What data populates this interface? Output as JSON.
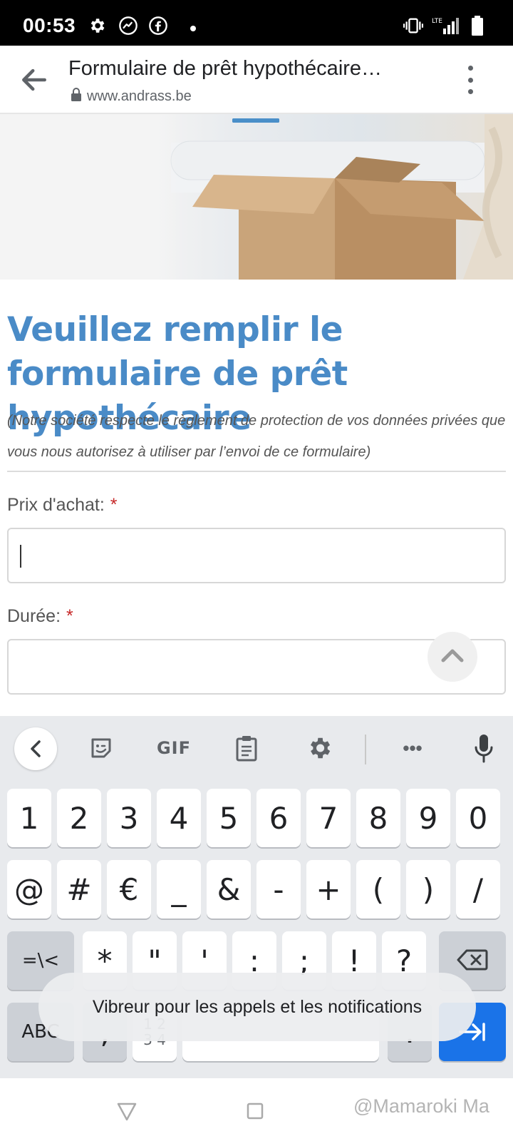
{
  "status_bar": {
    "time": "00:53",
    "network": "LTE",
    "icons": [
      "gear-icon",
      "messenger-icon",
      "facebook-icon",
      "notification-dot",
      "vibrate-icon",
      "lte-signal-icon",
      "battery-icon"
    ]
  },
  "browser": {
    "page_title": "Formulaire de prêt hypothécaire…",
    "url": "www.andrass.be"
  },
  "form": {
    "title": "Veuillez remplir le formulaire de prêt hypothécaire",
    "privacy_note": "(Notre société respecte le règlement de protection de vos données privées que vous nous autorisez à utiliser par l’envoi de ce formulaire)",
    "fields": [
      {
        "label": "Prix d'achat:",
        "required_mark": "*",
        "value": ""
      },
      {
        "label": "Durée:",
        "required_mark": "*",
        "value": ""
      }
    ]
  },
  "keyboard": {
    "toolbar": [
      "back-chevron-icon",
      "sticker-icon",
      "GIF",
      "clipboard-icon",
      "gear-icon",
      "more-icon",
      "mic-icon"
    ],
    "gif_label": "GIF",
    "more_label": "•••",
    "row1": [
      "1",
      "2",
      "3",
      "4",
      "5",
      "6",
      "7",
      "8",
      "9",
      "0"
    ],
    "row2": [
      "@",
      "#",
      "€",
      "_",
      "&",
      "-",
      "+",
      "(",
      ")",
      "/"
    ],
    "row3_left": "=\\<",
    "row3": [
      "*",
      "\"",
      "'",
      ":",
      ";",
      "!",
      "?"
    ],
    "row4": {
      "abc": "ABC",
      "comma": ",",
      "numpad_top": "1 2",
      "numpad_bottom": "3 4",
      "period": "."
    }
  },
  "toast": {
    "text": "Vibreur pour les appels et les notifications"
  },
  "watermark": {
    "text": "@Mamaroki Ma"
  },
  "colors": {
    "title_blue": "#4a8bc7",
    "required_red": "#c62828",
    "enter_blue": "#1a73e8"
  }
}
